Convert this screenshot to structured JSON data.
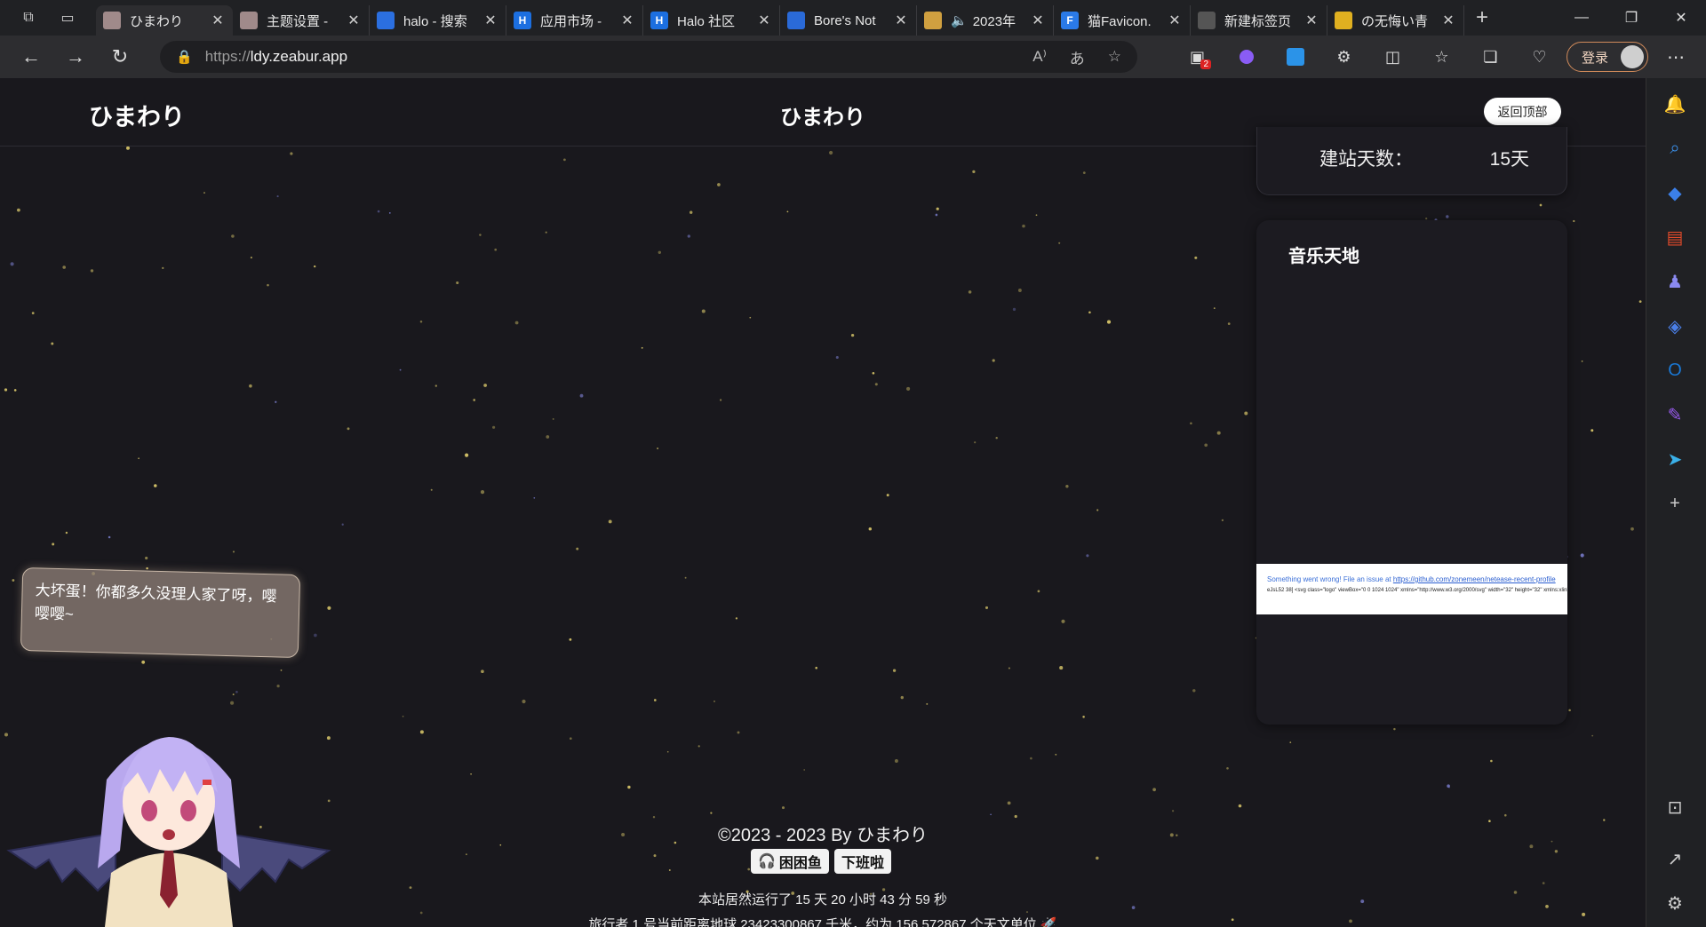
{
  "browser": {
    "tabs": [
      {
        "title": "ひまわり",
        "favicon": "image-favicon",
        "active": true
      },
      {
        "title": "主题设置 -",
        "favicon": "image-favicon"
      },
      {
        "title": "halo - 搜索",
        "favicon": "search-favicon"
      },
      {
        "title": "应用市场 -",
        "favicon": "halo-h-favicon",
        "badge_letter": "H"
      },
      {
        "title": "Halo 社区",
        "favicon": "halo-h-favicon",
        "badge_letter": "H"
      },
      {
        "title": "Bore's Not",
        "favicon": "bore-favicon"
      },
      {
        "title": "2023年",
        "favicon": "bird-favicon",
        "audio": true
      },
      {
        "title": "猫Favicon.",
        "favicon": "f-favicon",
        "badge_letter": "F"
      },
      {
        "title": "新建标签页",
        "favicon": "newtab-favicon"
      },
      {
        "title": "の无悔い青",
        "favicon": "star-favicon"
      }
    ],
    "url_scheme": "https://",
    "url_host": "ldy.zeabur.app",
    "login_label": "登录",
    "extension_badge": "2"
  },
  "site": {
    "logo": "ひまわり",
    "center_title": "ひまわり",
    "back_to_top": "返回顶部",
    "days_label": "建站天数：",
    "days_value": "15天",
    "music_title": "音乐天地",
    "music_error_text": "Something went wrong! File an issue at",
    "music_error_link": "https://github.com/zonemeen/netease-recent-profile",
    "music_error_code": "eJsL52 38] <svg class=\"logo\" viewBox=\"0 0 1024 1024\" xmlns=\"http://www.w3.org/2000/svg\" width=\"32\" height=\"32\" xmlns:xlink",
    "mascot_speech": "大坏蛋！你都多久没理人家了呀，嘤嘤嘤~",
    "footer_copyright": "©2023 - 2023 By ひまわり",
    "footer_badge_1": "困困鱼",
    "footer_badge_2": "下班啦",
    "footer_runtime": "本站居然运行了 15 天 20 小时 43 分 59 秒",
    "footer_travel": "旅行者 1 号当前距离地球 23423300867 千米，约为 156.572867 个天文单位 🚀"
  },
  "colors": {
    "page_bg": "#19181d",
    "star_yellow": "#d8c66a",
    "star_blue": "#7b7fd0",
    "login_border": "#d08a5a"
  }
}
